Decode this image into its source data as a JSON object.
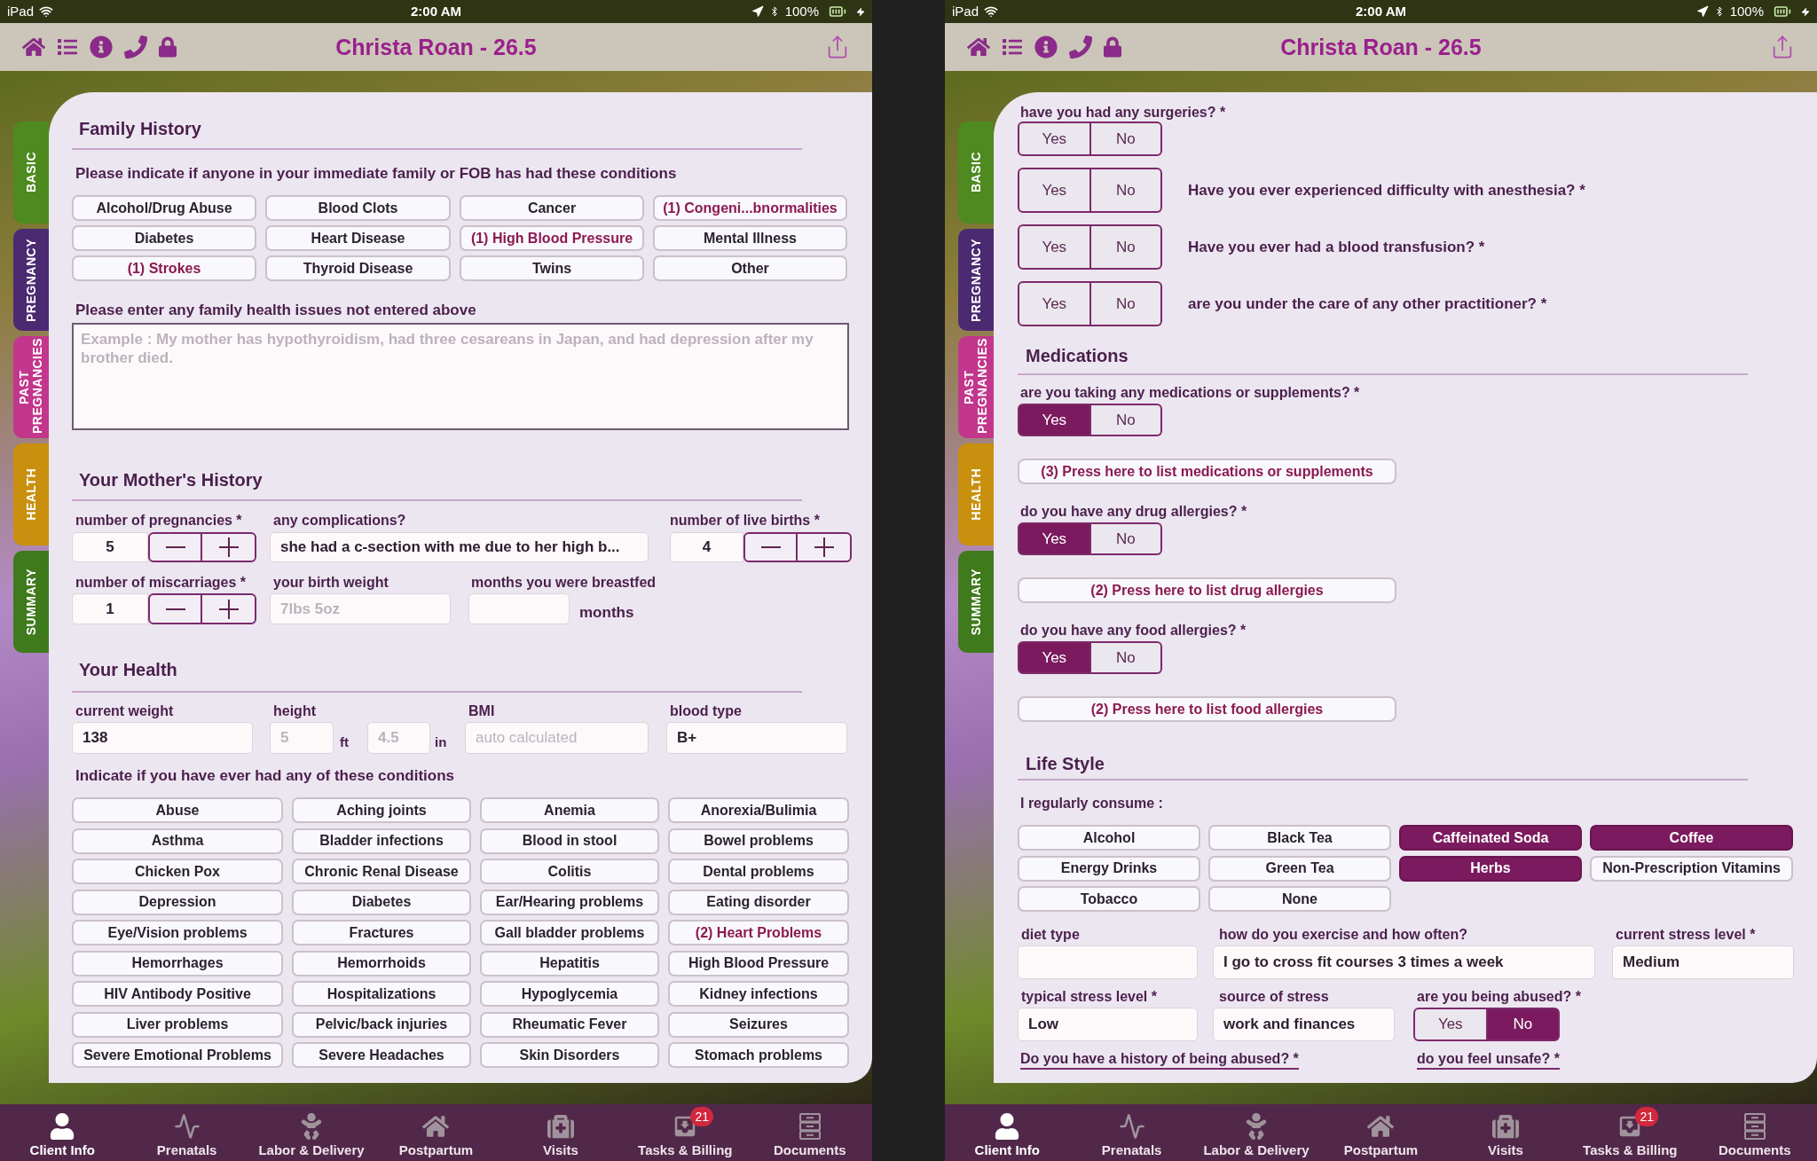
{
  "screens": [
    {
      "status_bar": {
        "device": "iPad",
        "time": "2:00 AM",
        "battery": "100%"
      },
      "nav_bar": {
        "title": "Christa Roan - 26.5"
      },
      "side_tabs": [
        {
          "label": "BASIC",
          "color": "#4e8a1f"
        },
        {
          "label": "PREGNANCY",
          "color": "#4b2a72"
        },
        {
          "label": "PAST PREGNANCIES",
          "color": "#c2368c"
        },
        {
          "label": "HEALTH",
          "color": "#c8900e"
        },
        {
          "label": "SUMMARY",
          "color": "#3f7a1c"
        }
      ],
      "family_history": {
        "title": "Family History",
        "prompt": "Please indicate if anyone in your immediate family or FOB has had these conditions",
        "conditions": [
          {
            "label": "Alcohol/Drug Abuse",
            "selected": false
          },
          {
            "label": "Blood Clots",
            "selected": false
          },
          {
            "label": "Cancer",
            "selected": false
          },
          {
            "label": "(1) Congeni...bnormalities",
            "selected": true
          },
          {
            "label": "Diabetes",
            "selected": false
          },
          {
            "label": "Heart Disease",
            "selected": false
          },
          {
            "label": "(1) High Blood Pressure",
            "selected": true
          },
          {
            "label": "Mental Illness",
            "selected": false
          },
          {
            "label": "(1) Strokes",
            "selected": true
          },
          {
            "label": "Thyroid Disease",
            "selected": false
          },
          {
            "label": "Twins",
            "selected": false
          },
          {
            "label": "Other",
            "selected": false
          }
        ],
        "notes": {
          "label": "Please enter any family health issues not entered above",
          "placeholder": "Example : My mother has hypothyroidism, had three cesareans in Japan, and had depression after my brother died."
        }
      },
      "mothers_history": {
        "title": "Your Mother's History",
        "pregnancies": {
          "label": "number of pregnancies *",
          "value": "5"
        },
        "complications": {
          "label": "any complications?",
          "value": "she had a c-section with me due to her high b..."
        },
        "live_births": {
          "label": "number of live births *",
          "value": "4"
        },
        "miscarriages": {
          "label": "number of miscarriages *",
          "value": "1"
        },
        "birth_weight": {
          "label": "your birth weight",
          "placeholder": "7lbs 5oz"
        },
        "breastfed": {
          "label": "months you were breastfed",
          "unit": "months"
        }
      },
      "your_health": {
        "title": "Your Health",
        "weight": {
          "label": "current weight",
          "value": "138"
        },
        "height": {
          "label": "height",
          "feet": {
            "placeholder": "5",
            "unit": "ft"
          },
          "inches": {
            "placeholder": "4.5",
            "unit": "in"
          }
        },
        "bmi": {
          "label": "BMI",
          "placeholder": "auto calculated"
        },
        "blood_type": {
          "label": "blood type",
          "value": "B+"
        },
        "prompt": "Indicate if you have ever had any of these conditions",
        "conditions": [
          {
            "label": "Abuse",
            "selected": false
          },
          {
            "label": "Aching joints",
            "selected": false
          },
          {
            "label": "Anemia",
            "selected": false
          },
          {
            "label": "Anorexia/Bulimia",
            "selected": false
          },
          {
            "label": "Asthma",
            "selected": false
          },
          {
            "label": "Bladder infections",
            "selected": false
          },
          {
            "label": "Blood in stool",
            "selected": false
          },
          {
            "label": "Bowel problems",
            "selected": false
          },
          {
            "label": "Chicken Pox",
            "selected": false
          },
          {
            "label": "Chronic Renal Disease",
            "selected": false
          },
          {
            "label": "Colitis",
            "selected": false
          },
          {
            "label": "Dental problems",
            "selected": false
          },
          {
            "label": "Depression",
            "selected": false
          },
          {
            "label": "Diabetes",
            "selected": false
          },
          {
            "label": "Ear/Hearing problems",
            "selected": false
          },
          {
            "label": "Eating disorder",
            "selected": false
          },
          {
            "label": "Eye/Vision problems",
            "selected": false
          },
          {
            "label": "Fractures",
            "selected": false
          },
          {
            "label": "Gall bladder problems",
            "selected": false
          },
          {
            "label": "(2) Heart Problems",
            "selected": true
          },
          {
            "label": "Hemorrhages",
            "selected": false
          },
          {
            "label": "Hemorrhoids",
            "selected": false
          },
          {
            "label": "Hepatitis",
            "selected": false
          },
          {
            "label": "High Blood Pressure",
            "selected": false
          },
          {
            "label": "HIV Antibody Positive",
            "selected": false
          },
          {
            "label": "Hospitalizations",
            "selected": false
          },
          {
            "label": "Hypoglycemia",
            "selected": false
          },
          {
            "label": "Kidney infections",
            "selected": false
          },
          {
            "label": "Liver problems",
            "selected": false
          },
          {
            "label": "Pelvic/back injuries",
            "selected": false
          },
          {
            "label": "Rheumatic Fever",
            "selected": false
          },
          {
            "label": "Seizures",
            "selected": false
          },
          {
            "label": "Severe Emotional Problems",
            "selected": false
          },
          {
            "label": "Severe Headaches",
            "selected": false
          },
          {
            "label": "Skin Disorders",
            "selected": false
          },
          {
            "label": "Stomach problems",
            "selected": false
          }
        ]
      },
      "bottom_tabs": [
        {
          "label": "Client Info",
          "selected": true
        },
        {
          "label": "Prenatals",
          "selected": false
        },
        {
          "label": "Labor & Delivery",
          "selected": false
        },
        {
          "label": "Postpartum",
          "selected": false
        },
        {
          "label": "Visits",
          "selected": false
        },
        {
          "label": "Tasks & Billing",
          "selected": false,
          "badge": "21"
        },
        {
          "label": "Documents",
          "selected": false
        }
      ]
    },
    {
      "status_bar": {
        "device": "iPad",
        "time": "2:00 AM",
        "battery": "100%"
      },
      "nav_bar": {
        "title": "Christa Roan - 26.5"
      },
      "side_tabs": [
        {
          "label": "BASIC",
          "color": "#4e8a1f"
        },
        {
          "label": "PREGNANCY",
          "color": "#4b2a72"
        },
        {
          "label": "PAST PREGNANCIES",
          "color": "#c2368c"
        },
        {
          "label": "HEALTH",
          "color": "#c8900e"
        },
        {
          "label": "SUMMARY",
          "color": "#3f7a1c"
        }
      ],
      "history_questions": [
        {
          "kind": "stacked",
          "question": "have you had any surgeries? *",
          "options": [
            {
              "label": "Yes",
              "selected": false
            },
            {
              "label": "No",
              "selected": false
            }
          ]
        },
        {
          "kind": "inline",
          "question": "Have you ever experienced difficulty with anesthesia? *",
          "options": [
            {
              "label": "Yes",
              "selected": false
            },
            {
              "label": "No",
              "selected": false
            }
          ]
        },
        {
          "kind": "inline",
          "question": "Have you ever had a blood transfusion? *",
          "options": [
            {
              "label": "Yes",
              "selected": false
            },
            {
              "label": "No",
              "selected": false
            }
          ]
        },
        {
          "kind": "inline",
          "question": "are you under the care of any other practitioner? *",
          "options": [
            {
              "label": "Yes",
              "selected": false
            },
            {
              "label": "No",
              "selected": false
            }
          ]
        }
      ],
      "medications": {
        "title": "Medications",
        "questions": [
          {
            "question": "are you taking any medications or supplements? *",
            "options": [
              {
                "label": "Yes",
                "selected": true
              },
              {
                "label": "No",
                "selected": false
              }
            ],
            "list_button": "(3) Press here to list medications or supplements"
          },
          {
            "question": "do you have any drug allergies? *",
            "options": [
              {
                "label": "Yes",
                "selected": true
              },
              {
                "label": "No",
                "selected": false
              }
            ],
            "list_button": "(2) Press here to list drug allergies"
          },
          {
            "question": "do you have any food allergies? *",
            "options": [
              {
                "label": "Yes",
                "selected": true
              },
              {
                "label": "No",
                "selected": false
              }
            ],
            "list_button": "(2) Press here to list food allergies"
          }
        ]
      },
      "life_style": {
        "title": "Life Style",
        "consume_label": "I regularly consume :",
        "consume": [
          {
            "label": "Alcohol",
            "selected": false
          },
          {
            "label": "Black Tea",
            "selected": false
          },
          {
            "label": "Caffeinated Soda",
            "selected": true
          },
          {
            "label": "Coffee",
            "selected": true
          },
          {
            "label": "Energy Drinks",
            "selected": false
          },
          {
            "label": "Green Tea",
            "selected": false
          },
          {
            "label": "Herbs",
            "selected": true
          },
          {
            "label": "Non-Prescription Vitamins",
            "selected": false
          },
          {
            "label": "Tobacco",
            "selected": false
          },
          {
            "label": "None",
            "selected": false
          }
        ],
        "diet_type": {
          "label": "diet type"
        },
        "exercise": {
          "label": "how do you exercise and how often?",
          "value": "I go to cross fit courses 3 times a week"
        },
        "current_stress": {
          "label": "current stress level *",
          "value": "Medium"
        },
        "typical_stress": {
          "label": "typical stress level *",
          "value": "Low"
        },
        "stress_source": {
          "label": "source of stress",
          "value": "work and finances"
        },
        "abused": {
          "question": "are you being abused? *",
          "options": [
            {
              "label": "Yes",
              "selected": false
            },
            {
              "label": "No",
              "selected": true
            }
          ]
        },
        "links": [
          "Do you have a history of being abused? *",
          "do you feel unsafe? *"
        ]
      },
      "bottom_tabs": [
        {
          "label": "Client Info",
          "selected": true
        },
        {
          "label": "Prenatals",
          "selected": false
        },
        {
          "label": "Labor & Delivery",
          "selected": false
        },
        {
          "label": "Postpartum",
          "selected": false
        },
        {
          "label": "Visits",
          "selected": false
        },
        {
          "label": "Tasks & Billing",
          "selected": false,
          "badge": "21"
        },
        {
          "label": "Documents",
          "selected": false
        }
      ]
    }
  ]
}
